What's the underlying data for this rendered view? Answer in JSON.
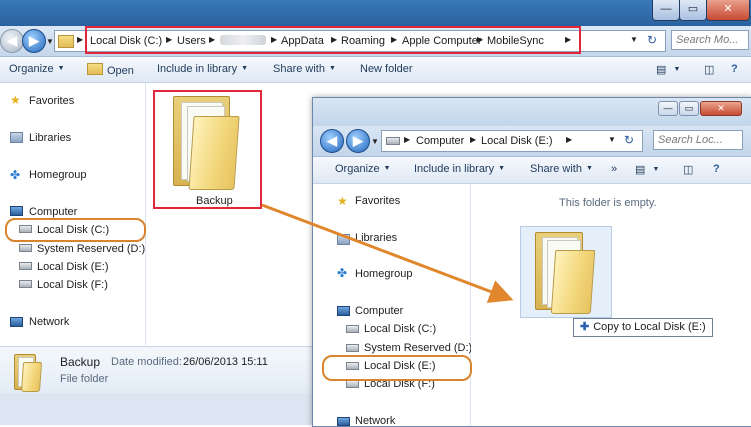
{
  "outer": {
    "address": [
      "Local Disk (C:)",
      "Users",
      "",
      "AppData",
      "Roaming",
      "Apple Computer",
      "MobileSync"
    ],
    "search_placeholder": "Search Mo...",
    "toolbar": {
      "organize": "Organize",
      "open": "Open",
      "include_in_library": "Include in library",
      "share_with": "Share with",
      "new_folder": "New folder"
    },
    "nav": {
      "favorites": "Favorites",
      "libraries": "Libraries",
      "homegroup": "Homegroup",
      "computer": "Computer",
      "drives": [
        "Local Disk (C:)",
        "System Reserved (D:)",
        "Local Disk (E:)",
        "Local Disk (F:)"
      ],
      "network": "Network"
    },
    "folder_name": "Backup",
    "details": {
      "name": "Backup",
      "modified_label": "Date modified:",
      "modified_value": "26/06/2013 15:11",
      "type": "File folder"
    }
  },
  "inner": {
    "address": [
      "Computer",
      "Local Disk (E:)"
    ],
    "search_placeholder": "Search Loc...",
    "toolbar": {
      "organize": "Organize",
      "include_in_library": "Include in library",
      "share_with": "Share with",
      "more": "»"
    },
    "nav": {
      "favorites": "Favorites",
      "libraries": "Libraries",
      "homegroup": "Homegroup",
      "computer": "Computer",
      "drives": [
        "Local Disk (C:)",
        "System Reserved (D:)",
        "Local Disk (E:)",
        "Local Disk (F:)"
      ],
      "network": "Network"
    },
    "empty_message": "This folder is empty.",
    "drag_tooltip": "Copy to Local Disk (E:)"
  },
  "colors": {
    "highlight_red": "#e0283a",
    "highlight_orange": "#d9842c",
    "arrow": "#e0862c"
  }
}
